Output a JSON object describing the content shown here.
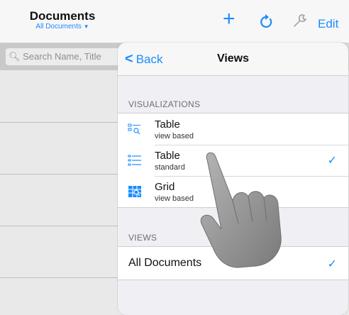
{
  "header": {
    "title": "Documents",
    "subtitle": "All Documents",
    "edit_label": "Edit",
    "icons": [
      "plus-icon",
      "refresh-icon",
      "wrench-icon"
    ]
  },
  "search": {
    "placeholder": "Search Name, Title"
  },
  "popover": {
    "back_label": "Back",
    "title": "Views",
    "visualizations_header": "VISUALIZATIONS",
    "visualizations": [
      {
        "name": "Table",
        "sub": "view based",
        "checked": false
      },
      {
        "name": "Table",
        "sub": "standard",
        "checked": true
      },
      {
        "name": "Grid",
        "sub": "view based",
        "checked": false
      }
    ],
    "views_header": "VIEWS",
    "views": [
      {
        "name": "All Documents",
        "checked": true
      }
    ],
    "check_glyph": "✓"
  },
  "colors": {
    "accent": "#1a8cff"
  }
}
